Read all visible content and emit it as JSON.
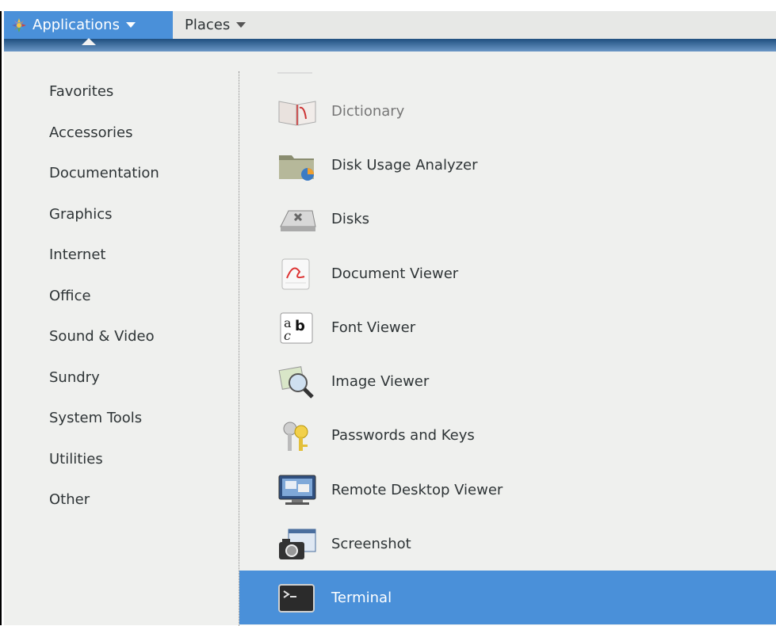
{
  "top_bar": {
    "applications_label": "Applications",
    "places_label": "Places"
  },
  "categories": [
    "Favorites",
    "Accessories",
    "Documentation",
    "Graphics",
    "Internet",
    "Office",
    "Sound & Video",
    "Sundry",
    "System Tools",
    "Utilities",
    "Other"
  ],
  "apps": [
    {
      "label": "Dictionary",
      "icon": "dictionary-icon",
      "state": "dimmed"
    },
    {
      "label": "Disk Usage Analyzer",
      "icon": "disk-usage-analyzer-icon"
    },
    {
      "label": "Disks",
      "icon": "disks-icon"
    },
    {
      "label": "Document Viewer",
      "icon": "document-viewer-icon"
    },
    {
      "label": "Font Viewer",
      "icon": "font-viewer-icon"
    },
    {
      "label": "Image Viewer",
      "icon": "image-viewer-icon"
    },
    {
      "label": "Passwords and Keys",
      "icon": "passwords-and-keys-icon"
    },
    {
      "label": "Remote Desktop Viewer",
      "icon": "remote-desktop-viewer-icon"
    },
    {
      "label": "Screenshot",
      "icon": "screenshot-icon"
    },
    {
      "label": "Terminal",
      "icon": "terminal-icon",
      "state": "selected"
    }
  ],
  "colors": {
    "accent": "#4a90d9",
    "menu_bg": "#eff0ee",
    "panel_bg": "#e7e8e6",
    "text": "#2e3436"
  }
}
